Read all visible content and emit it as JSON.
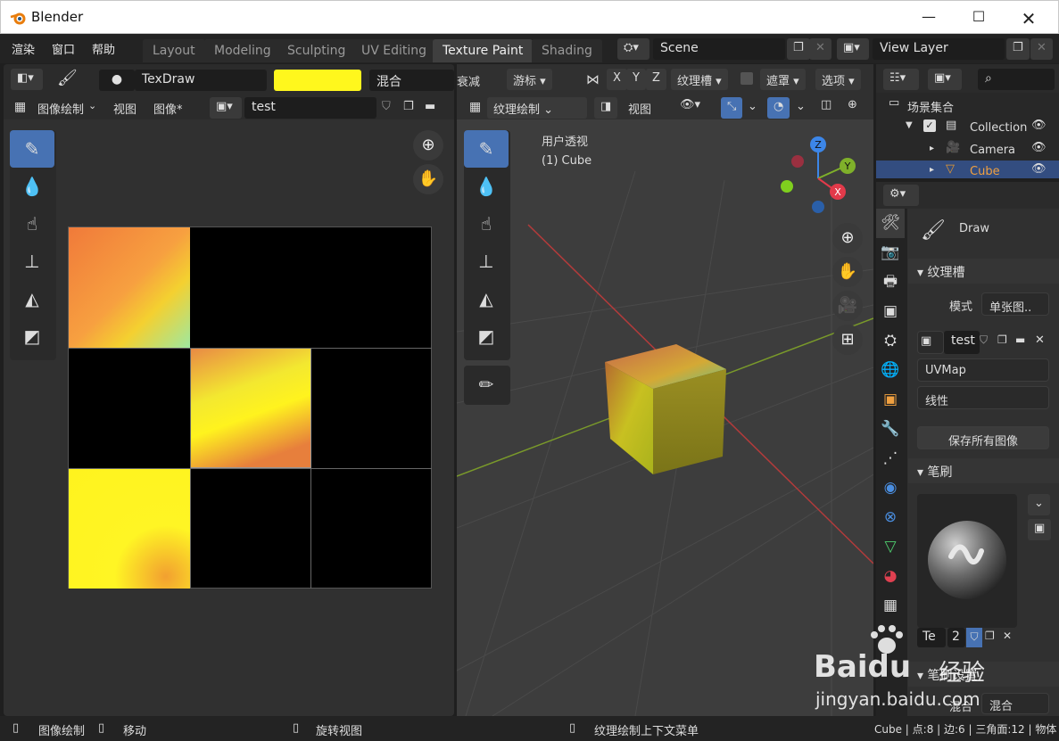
{
  "window": {
    "title": "Blender"
  },
  "menus": [
    "渲染",
    "窗口",
    "帮助"
  ],
  "workspaces": [
    "Layout",
    "Modeling",
    "Sculpting",
    "UV Editing",
    "Texture Paint",
    "Shading"
  ],
  "scene": "Scene",
  "view_layer": "View Layer",
  "image_editor": {
    "brush_name": "TexDraw",
    "brush_color": "#fff71d",
    "blend": "混合",
    "mode": "图像绘制",
    "menu_view": "视图",
    "menu_image": "图像*",
    "image_name": "test"
  },
  "viewport": {
    "falloff": "衰减",
    "cursor": "游标",
    "axes": [
      "X",
      "Y",
      "Z"
    ],
    "texture_slots": "纹理槽",
    "mask": "遮罩",
    "options": "选项",
    "mode": "纹理绘制",
    "menu_view": "视图",
    "overlay_label": "用户透视",
    "overlay_object": "(1) Cube",
    "gizmo": {
      "z": "Z",
      "y": "Y",
      "x": "X"
    }
  },
  "outliner": {
    "scene_collection": "场景集合",
    "items": [
      {
        "label": "Collection"
      },
      {
        "label": "Camera"
      },
      {
        "label": "Cube"
      }
    ]
  },
  "properties": {
    "brush": "Draw",
    "texture_slots_panel": "纹理槽",
    "mode_label": "模式",
    "mode_value": "单张图..",
    "image": "test",
    "uvmap": "UVMap",
    "interpolation": "线性",
    "save_all": "保存所有图像",
    "brush_panel": "笔刷",
    "brush_field": "Te",
    "brush_users": "2",
    "bottom_panel": "笔刷设置",
    "blend_label": "混合",
    "blend_value": "混合"
  },
  "statusbar": {
    "item1": "图像绘制",
    "item2": "移动",
    "item3": "旋转视图",
    "item4": "纹理绘制上下文菜单",
    "stats": "Cube | 点:8 | 边:6 | 三角面:12 | 物体"
  },
  "watermark": {
    "text1": "Baidu",
    "text2": "经验",
    "url": "jingyan.baidu.com"
  }
}
